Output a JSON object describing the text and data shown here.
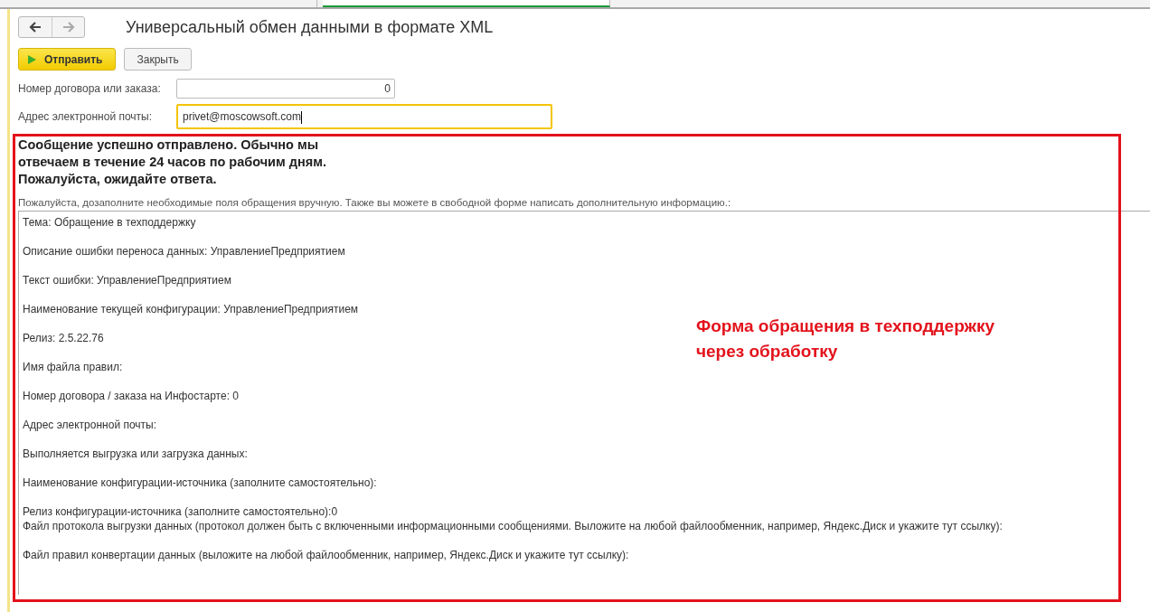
{
  "tabs": [
    {
      "selected": false
    },
    {
      "selected": true
    }
  ],
  "window": {
    "title": "Универсальный обмен данными в формате XML"
  },
  "buttons": [
    {
      "kind": "primary",
      "label": "Отправить"
    },
    {
      "kind": "plain",
      "label": "Закрыть"
    }
  ],
  "fields": [
    {
      "label": "Номер договора или заказа:",
      "value": "0",
      "kind": "number",
      "focused": false
    },
    {
      "label": "Адрес электронной почты:",
      "value": "privet@moscowsoft.com",
      "kind": "text",
      "focused": true
    }
  ],
  "message": "Сообщение успешно отправлено. Обычно мы\nотвечаем в течение 24 часов по рабочим дням.\nПожалуйста, ожидайте ответа.",
  "hint": "Пожалуйста, дозаполните необходимые поля обращения вручную. Также вы можете в свободной форме написать дополнительную информацию.:",
  "memo": {
    "value": "Тема: Обращение в техподдержку\n\nОписание ошибки переноса данных: УправлениеПредприятием\n\nТекст ошибки: УправлениеПредприятием\n\nНаименование текущей конфигурации: УправлениеПредприятием\n\nРелиз: 2.5.22.76\n\nИмя файла правил: \n\nНомер договора / заказа на Инфостарте: 0\n\nАдрес электронной почты: \n\nВыполняется выгрузка или загрузка данных: \n\nНаименование конфигурации-источника (заполните самостоятельно): \n\nРелиз конфигурации-источника (заполните самостоятельно):0\nФайл протокола выгрузки данных (протокол должен быть с включенными информационными сообщениями. Выложите на любой файлообменник, например, Яндекс.Диск и укажите тут ссылку): \n\nФайл правил конвертации данных (выложите на любой файлообменник, например, Яндекс.Диск и укажите тут ссылку): "
  },
  "annotation": "Форма обращения в техподдержку\nчерез обработку"
}
